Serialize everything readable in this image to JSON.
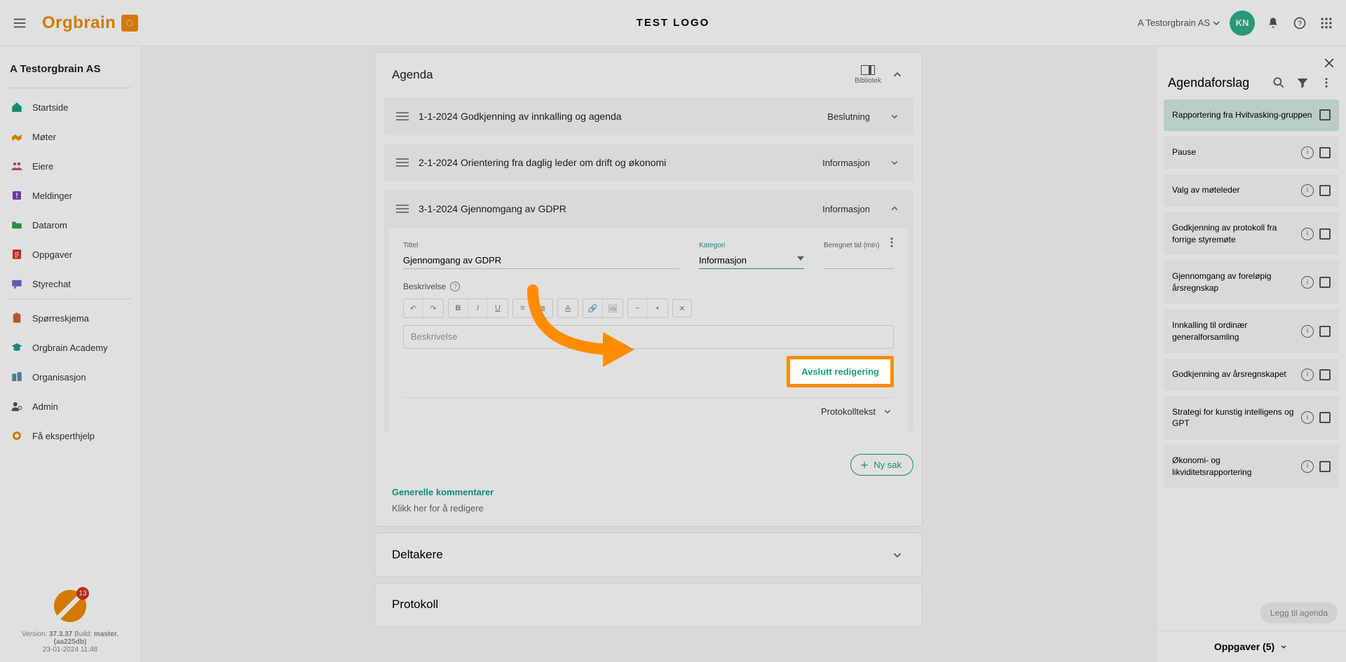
{
  "topbar": {
    "title": "TEST LOGO",
    "org": "A Testorgbrain AS",
    "avatar": "KN",
    "brand": "Orgbrain"
  },
  "sidebar": {
    "org": "A Testorgbrain AS",
    "items": [
      {
        "label": "Startside",
        "icon": "home",
        "color": "#1a9e7f"
      },
      {
        "label": "Møter",
        "icon": "handshake",
        "color": "#ef8b00"
      },
      {
        "label": "Eiere",
        "icon": "people",
        "color": "#c44d87"
      },
      {
        "label": "Meldinger",
        "icon": "exclaim",
        "color": "#7b3fb8"
      },
      {
        "label": "Datarom",
        "icon": "folder",
        "color": "#2da04a"
      },
      {
        "label": "Oppgaver",
        "icon": "task",
        "color": "#d93025"
      },
      {
        "label": "Styrechat",
        "icon": "chat",
        "color": "#6b6bc7"
      },
      {
        "label": "Spørreskjema",
        "icon": "clipboard",
        "color": "#d1603d"
      },
      {
        "label": "Orgbrain Academy",
        "icon": "academy",
        "color": "#1a9e7f"
      },
      {
        "label": "Organisasjon",
        "icon": "building",
        "color": "#5b8aa6"
      },
      {
        "label": "Admin",
        "icon": "admin",
        "color": "#555"
      },
      {
        "label": "Få eksperthjelp",
        "icon": "expert",
        "color": "#ef8b00"
      }
    ],
    "badge": "13",
    "version_label": "Version:",
    "version": "37.3.37",
    "build_label": "Build:",
    "build": "master.(aa225db)",
    "timestamp": "23-01-2024 11:48"
  },
  "agenda": {
    "title": "Agenda",
    "bibliotek": "Bibliotek",
    "items": [
      {
        "num": "1-1-2024",
        "title": "Godkjenning av innkalling og agenda",
        "cat": "Beslutning"
      },
      {
        "num": "2-1-2024",
        "title": "Orientering fra daglig leder om drift og økonomi",
        "cat": "Informasjon"
      },
      {
        "num": "3-1-2024",
        "title": "Gjennomgang av GDPR",
        "cat": "Informasjon"
      }
    ],
    "form": {
      "tittel_label": "Tittel",
      "tittel_value": "Gjennomgang av GDPR",
      "kategori_label": "Kategori",
      "kategori_value": "Informasjon",
      "beregnet_label": "Beregnet tid (min)",
      "beskrivelse_label": "Beskrivelse",
      "beskrivelse_placeholder": "Beskrivelse",
      "finish_label": "Avslutt redigering",
      "protokoll_label": "Protokolltekst"
    },
    "ny_sak": "Ny sak",
    "comments_label": "Generelle kommentarer",
    "comments_hint": "Klikk her for å redigere"
  },
  "cards": {
    "deltakere": "Deltakere",
    "protokoll": "Protokoll"
  },
  "rightPanel": {
    "title": "Agendaforslag",
    "items": [
      {
        "label": "Rapportering fra Hvitvasking-gruppen",
        "hl": true,
        "info": false
      },
      {
        "label": "Pause",
        "info": true
      },
      {
        "label": "Valg av møteleder",
        "info": true
      },
      {
        "label": "Godkjenning av protokoll fra forrige styremøte",
        "info": true
      },
      {
        "label": "Gjennomgang av foreløpig årsregnskap",
        "info": true
      },
      {
        "label": "Innkalling til ordinær generalforsamling",
        "info": true
      },
      {
        "label": "Godkjenning av årsregnskapet",
        "info": true
      },
      {
        "label": "Strategi for kunstig intelligens og GPT",
        "info": true
      },
      {
        "label": "Økonomi- og likviditetsrapportering",
        "info": true
      }
    ],
    "add_label": "Legg til agenda",
    "footer": "Oppgaver (5)"
  }
}
